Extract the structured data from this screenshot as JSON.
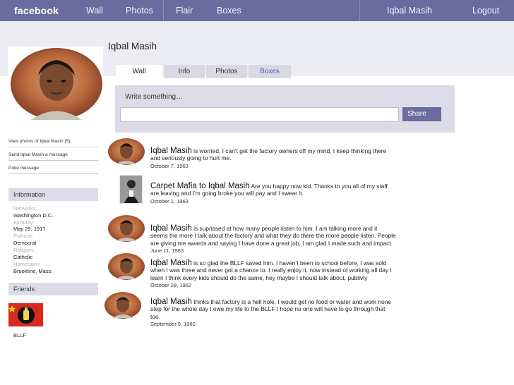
{
  "nav": {
    "logo": "facebook",
    "wall": "Wall",
    "photos": "Photos",
    "flair": "Flair",
    "boxes": "Boxes",
    "user": "Iqbal Masih",
    "logout": "Logout"
  },
  "profile": {
    "name": "Iqbal Masih",
    "tabs": [
      "Wall",
      "Info",
      "Photos",
      "Boxes"
    ]
  },
  "composer": {
    "prompt": "Write something…",
    "share": "Share"
  },
  "sidebar": {
    "links": [
      "View photos of Iqbal Masih (5)",
      "Send Iqbal Masih a message",
      "Poke message"
    ],
    "info_heading": "Information",
    "info": [
      {
        "label": "Networks:",
        "value": "Washington D.C."
      },
      {
        "label": "Birthday:",
        "value": "May 29, 1917"
      },
      {
        "label": "Political:",
        "value": "Democrat"
      },
      {
        "label": "Religion:",
        "value": "Catholic"
      },
      {
        "label": "Hometown:",
        "value": "Brookline, Mass."
      }
    ],
    "friends_heading": "Friends",
    "friend_name": "BLLF"
  },
  "posts": [
    {
      "author": "Iqbal Masih",
      "text": " is worried. I can’t get the factory owners off my mind, I keep thinking there and seriously going to hurt me.",
      "date": "October 7, 1963"
    },
    {
      "author": "Carpet Mafia to Iqbal Masih",
      "text": " Are you happy now kid. Thanks to you all of my staff are leaving and I’m going broke you will pay and I swear it.",
      "date": "October 1, 1963"
    },
    {
      "author": "Iqbal Masih",
      "text": " is suprissed at how many people listen to him. I am talking more and it seems the more I talk about the factory and what they do there the more people listen. People are giving me awards and saying I have done a great job, I am glad I made such and impact.",
      "date": "June 11, 1963"
    },
    {
      "author": "Iqbal Masih",
      "text": " is so glad the BLLF saved him. I haven’t been to school before, I was sold when I was three and never got a chance to. I really enjoy it, now instead of working all day I learn I think every kids should do the same, hey maybe I should talk about, publivly",
      "date": "October 28, 1962"
    },
    {
      "author": "Iqbal Masih",
      "text": " thinks that factory is a hell hole, I would get no food or water and work none stop for the whole day I owe my life to the BLLF I hope no one will have to go through that too.",
      "date": "September 9, 1962"
    }
  ],
  "colors": {
    "nav_bar": "#6a6b9e",
    "band": "#ececf3",
    "panel": "#dcdce8",
    "tab_link": "#4a57b2"
  }
}
